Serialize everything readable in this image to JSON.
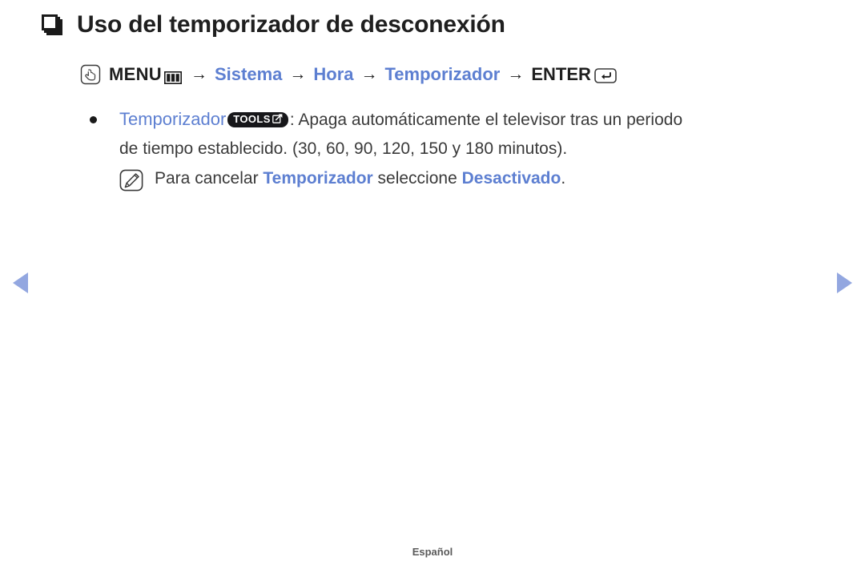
{
  "page": {
    "language_footer": "Español",
    "accent_blue": "#5d7fd1",
    "nav_arrow_color": "#93a7e0",
    "text_color": "#3a3a3a"
  },
  "title": {
    "bullet_icon": "stacked-square-icon",
    "text": "Uso del temporizador de desconexión"
  },
  "menu_path": {
    "hand_icon": "hand-pointer-icon",
    "menu_label": "MENU",
    "menu_button_icon": "menu-button-icon",
    "separator": "→",
    "steps": [
      {
        "label": "Sistema",
        "style": "blue"
      },
      {
        "label": "Hora",
        "style": "blue"
      },
      {
        "label": "Temporizador",
        "style": "blue"
      },
      {
        "label": "ENTER",
        "style": "dark"
      }
    ],
    "enter_icon": "enter-key-icon"
  },
  "bullet": {
    "dot_icon": "bullet-dot-icon",
    "term": "Temporizador",
    "tools_badge": {
      "label": "TOOLS",
      "icon": "tools-arrow-icon"
    },
    "line1_rest": ": Apaga automáticamente el televisor tras un periodo",
    "line2": "de tiempo establecido. (30, 60, 90, 120, 150 y 180 minutos)."
  },
  "note": {
    "icon": "note-pencil-icon",
    "prefix": "Para cancelar ",
    "term1": "Temporizador",
    "middle": " seleccione ",
    "term2": "Desactivado",
    "suffix": "."
  },
  "navigation": {
    "prev_icon": "previous-page-arrow-icon",
    "next_icon": "next-page-arrow-icon"
  }
}
